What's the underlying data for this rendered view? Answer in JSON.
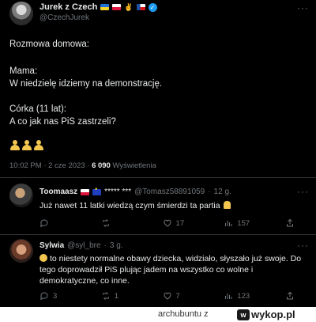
{
  "main_tweet": {
    "display_name": "Jurek z Czech",
    "handle": "@CzechJurek",
    "text_lines": [
      "Rozmowa domowa:",
      "Mama:",
      "W niedzielę idziemy na demonstrację.",
      "Córka (11 lat):",
      "A co jak nas PiS zastrzeli?"
    ],
    "time": "10:02 PM",
    "date": "2 cze 2023",
    "views_count": "6 090",
    "views_label": "Wyświetlenia",
    "separator": "·"
  },
  "replies": [
    {
      "name": "Toomaasz",
      "asterisks": "***** ***",
      "handle": "@Tomasz58891059",
      "time": "12 g.",
      "text": "Już nawet 11 latki wiedzą czym śmierdzi ta partia",
      "retweets": "",
      "likes": "17",
      "views": "157"
    },
    {
      "name": "Sylwia",
      "handle": "@syl_bre",
      "time": "3 g.",
      "text": "to niestety normalne obawy dziecka, widziało, słyszało już swoje. Do tego doprowadził PiS plując jadem na wszystko co wolne i demokratyczne, co inne.",
      "replies": "3",
      "retweets": "1",
      "likes": "7",
      "views": "123"
    }
  ],
  "footer": {
    "user": "archubuntu",
    "z": "z",
    "site": "wykop.pl"
  },
  "icons": [
    "more-icon",
    "verified-icon",
    "reply-icon",
    "retweet-icon",
    "like-icon",
    "views-icon",
    "share-icon"
  ],
  "colors": {
    "background": "#000000",
    "text": "#e7e9ea",
    "muted": "#71767b",
    "divider": "#2f3336",
    "verified": "#1d9bf0"
  }
}
